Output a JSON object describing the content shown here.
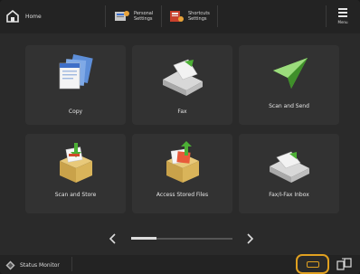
{
  "header": {
    "home_label": "Home",
    "shortcuts": [
      {
        "label": "Personal Settings"
      },
      {
        "label": "Shortcuts Settings"
      }
    ],
    "menu_label": "Menu"
  },
  "tiles": [
    {
      "label": "Copy",
      "icon": "copy-icon"
    },
    {
      "label": "Fax",
      "icon": "fax-icon"
    },
    {
      "label": "Scan and Send",
      "icon": "scan-and-send-icon"
    },
    {
      "label": "Scan and Store",
      "icon": "scan-and-store-icon"
    },
    {
      "label": "Access Stored Files",
      "icon": "access-stored-files-icon"
    },
    {
      "label": "Fax/I-Fax Inbox",
      "icon": "fax-inbox-icon"
    }
  ],
  "pager": {
    "prev_icon": "chevron-left-icon",
    "next_icon": "chevron-right-icon",
    "page": 1
  },
  "footer": {
    "status_monitor_label": "Status Monitor",
    "stop_icon": "stop-icon",
    "swap_icon": "swap-icon"
  },
  "colors": {
    "accent": "#e0a020",
    "green": "#4caf35"
  }
}
